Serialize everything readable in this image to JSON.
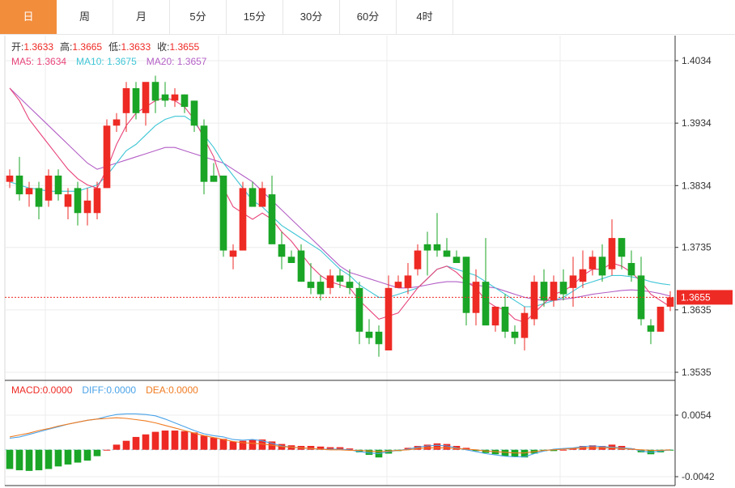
{
  "tabs": [
    "日",
    "周",
    "月",
    "5分",
    "15分",
    "30分",
    "60分",
    "4时"
  ],
  "active_tab": 0,
  "colors": {
    "up": "#ee2a24",
    "down": "#1aa526",
    "ma5": "#e8457a",
    "ma10": "#3fc6d6",
    "ma20": "#b35fc6",
    "diff": "#4aa3e8",
    "dea": "#f07c22",
    "accent": "#f28d3c"
  },
  "chart_data": [
    {
      "type": "candlestick",
      "ohlc_labels": {
        "open_label": "开:",
        "open": "1.3633",
        "high_label": "高:",
        "high": "1.3665",
        "low_label": "低:",
        "low": "1.3633",
        "close_label": "收:",
        "close": "1.3655"
      },
      "ma_labels": {
        "ma5": "MA5: 1.3634",
        "ma10": "MA10: 1.3675",
        "ma20": "MA20: 1.3657"
      },
      "y_ticks": [
        "1.4034",
        "1.3934",
        "1.3834",
        "1.3735",
        "1.3635",
        "1.3535"
      ],
      "y_tick_values": [
        1.4034,
        1.3934,
        1.3834,
        1.3735,
        1.3635,
        1.3535
      ],
      "ylim": [
        1.3535,
        1.4034
      ],
      "current_price": "1.3655",
      "current_value": 1.3655,
      "candles": [
        [
          1.384,
          1.386,
          1.383,
          1.385
        ],
        [
          1.385,
          1.388,
          1.381,
          1.382
        ],
        [
          1.382,
          1.384,
          1.38,
          1.383
        ],
        [
          1.383,
          1.384,
          1.378,
          1.38
        ],
        [
          1.381,
          1.386,
          1.38,
          1.385
        ],
        [
          1.385,
          1.386,
          1.381,
          1.382
        ],
        [
          1.38,
          1.383,
          1.378,
          1.382
        ],
        [
          1.383,
          1.384,
          1.377,
          1.379
        ],
        [
          1.379,
          1.383,
          1.377,
          1.381
        ],
        [
          1.379,
          1.384,
          1.378,
          1.383
        ],
        [
          1.383,
          1.394,
          1.383,
          1.393
        ],
        [
          1.393,
          1.395,
          1.392,
          1.394
        ],
        [
          1.395,
          1.4,
          1.392,
          1.399
        ],
        [
          1.399,
          1.4,
          1.394,
          1.395
        ],
        [
          1.395,
          1.399,
          1.393,
          1.4
        ],
        [
          1.4,
          1.401,
          1.395,
          1.397
        ],
        [
          1.398,
          1.4,
          1.396,
          1.397
        ],
        [
          1.397,
          1.399,
          1.396,
          1.398
        ],
        [
          1.398,
          1.398,
          1.395,
          1.396
        ],
        [
          1.397,
          1.397,
          1.392,
          1.393
        ],
        [
          1.393,
          1.394,
          1.382,
          1.384
        ],
        [
          1.385,
          1.387,
          1.384,
          1.384
        ],
        [
          1.385,
          1.385,
          1.372,
          1.373
        ],
        [
          1.372,
          1.374,
          1.37,
          1.373
        ],
        [
          1.373,
          1.384,
          1.373,
          1.383
        ],
        [
          1.383,
          1.384,
          1.38,
          1.38
        ],
        [
          1.38,
          1.384,
          1.38,
          1.383
        ],
        [
          1.382,
          1.385,
          1.379,
          1.374
        ],
        [
          1.374,
          1.376,
          1.37,
          1.372
        ],
        [
          1.372,
          1.373,
          1.371,
          1.371
        ],
        [
          1.373,
          1.374,
          1.368,
          1.368
        ],
        [
          1.368,
          1.371,
          1.366,
          1.367
        ],
        [
          1.368,
          1.369,
          1.365,
          1.366
        ],
        [
          1.367,
          1.37,
          1.366,
          1.369
        ],
        [
          1.369,
          1.37,
          1.367,
          1.368
        ],
        [
          1.368,
          1.37,
          1.366,
          1.367
        ],
        [
          1.367,
          1.368,
          1.358,
          1.36
        ],
        [
          1.36,
          1.362,
          1.358,
          1.359
        ],
        [
          1.36,
          1.361,
          1.356,
          1.358
        ],
        [
          1.357,
          1.369,
          1.357,
          1.367
        ],
        [
          1.367,
          1.369,
          1.367,
          1.368
        ],
        [
          1.367,
          1.371,
          1.366,
          1.369
        ],
        [
          1.37,
          1.374,
          1.369,
          1.373
        ],
        [
          1.374,
          1.376,
          1.369,
          1.373
        ],
        [
          1.374,
          1.379,
          1.372,
          1.373
        ],
        [
          1.373,
          1.375,
          1.372,
          1.372
        ],
        [
          1.372,
          1.373,
          1.371,
          1.371
        ],
        [
          1.372,
          1.372,
          1.361,
          1.363
        ],
        [
          1.363,
          1.37,
          1.361,
          1.368
        ],
        [
          1.368,
          1.375,
          1.363,
          1.361
        ],
        [
          1.361,
          1.364,
          1.36,
          1.364
        ],
        [
          1.364,
          1.366,
          1.359,
          1.36
        ],
        [
          1.36,
          1.361,
          1.358,
          1.359
        ],
        [
          1.359,
          1.364,
          1.357,
          1.363
        ],
        [
          1.362,
          1.369,
          1.361,
          1.368
        ],
        [
          1.368,
          1.37,
          1.364,
          1.365
        ],
        [
          1.365,
          1.369,
          1.364,
          1.368
        ],
        [
          1.368,
          1.37,
          1.365,
          1.366
        ],
        [
          1.367,
          1.372,
          1.364,
          1.369
        ],
        [
          1.368,
          1.373,
          1.367,
          1.37
        ],
        [
          1.37,
          1.373,
          1.369,
          1.372
        ],
        [
          1.372,
          1.374,
          1.368,
          1.369
        ],
        [
          1.37,
          1.378,
          1.369,
          1.375
        ],
        [
          1.375,
          1.375,
          1.37,
          1.372
        ],
        [
          1.371,
          1.373,
          1.368,
          1.369
        ],
        [
          1.369,
          1.372,
          1.361,
          1.362
        ],
        [
          1.361,
          1.362,
          1.358,
          1.36
        ],
        [
          1.36,
          1.364,
          1.36,
          1.364
        ],
        [
          1.364,
          1.3665,
          1.3633,
          1.3655
        ]
      ],
      "ma5_values": [
        1.399,
        1.397,
        1.394,
        1.392,
        1.39,
        1.388,
        1.386,
        1.3845,
        1.3835,
        1.383,
        1.386,
        1.39,
        1.393,
        1.395,
        1.396,
        1.397,
        1.3975,
        1.397,
        1.396,
        1.394,
        1.391,
        1.388,
        1.383,
        1.38,
        1.379,
        1.378,
        1.379,
        1.378,
        1.376,
        1.3745,
        1.3725,
        1.3705,
        1.369,
        1.368,
        1.3675,
        1.367,
        1.365,
        1.3635,
        1.362,
        1.3625,
        1.363,
        1.365,
        1.367,
        1.3685,
        1.37,
        1.3705,
        1.3695,
        1.368,
        1.367,
        1.365,
        1.364,
        1.3635,
        1.362,
        1.3615,
        1.363,
        1.3645,
        1.366,
        1.3665,
        1.3675,
        1.369,
        1.37,
        1.37,
        1.371,
        1.3705,
        1.3695,
        1.368,
        1.366,
        1.365,
        1.364
      ],
      "ma10_values": [
        1.384,
        1.3835,
        1.383,
        1.3828,
        1.3825,
        1.3825,
        1.3825,
        1.3825,
        1.383,
        1.3835,
        1.385,
        1.387,
        1.389,
        1.39,
        1.3915,
        1.393,
        1.394,
        1.3945,
        1.3945,
        1.3935,
        1.3915,
        1.3895,
        1.387,
        1.385,
        1.383,
        1.381,
        1.38,
        1.3785,
        1.377,
        1.376,
        1.375,
        1.374,
        1.373,
        1.3715,
        1.37,
        1.369,
        1.3675,
        1.3665,
        1.3655,
        1.3655,
        1.366,
        1.3665,
        1.367,
        1.3685,
        1.37,
        1.3705,
        1.37,
        1.3695,
        1.369,
        1.368,
        1.367,
        1.366,
        1.365,
        1.364,
        1.364,
        1.3645,
        1.365,
        1.3655,
        1.3665,
        1.3675,
        1.368,
        1.3685,
        1.369,
        1.369,
        1.3688,
        1.3685,
        1.368,
        1.3677,
        1.3675
      ],
      "ma20_values": [
        1.399,
        1.3975,
        1.396,
        1.3945,
        1.393,
        1.3915,
        1.39,
        1.3885,
        1.387,
        1.386,
        1.3865,
        1.387,
        1.3875,
        1.388,
        1.3885,
        1.389,
        1.3895,
        1.3895,
        1.389,
        1.3885,
        1.388,
        1.3875,
        1.387,
        1.386,
        1.385,
        1.384,
        1.3825,
        1.381,
        1.3795,
        1.378,
        1.3765,
        1.375,
        1.3735,
        1.372,
        1.3705,
        1.3695,
        1.369,
        1.3685,
        1.368,
        1.3675,
        1.367,
        1.367,
        1.3672,
        1.3675,
        1.3678,
        1.368,
        1.368,
        1.3678,
        1.3675,
        1.3672,
        1.367,
        1.3665,
        1.366,
        1.3655,
        1.3652,
        1.365,
        1.365,
        1.3652,
        1.3654,
        1.3657,
        1.366,
        1.3662,
        1.3664,
        1.3666,
        1.3667,
        1.3666,
        1.3664,
        1.3661,
        1.3657
      ]
    },
    {
      "type": "bar",
      "labels": {
        "macd": "MACD:0.0000",
        "diff": "DIFF:0.0000",
        "dea": "DEA:0.0000"
      },
      "y_ticks": [
        "0.0054",
        "-0.0042"
      ],
      "y_tick_values": [
        0.0054,
        -0.0042
      ],
      "ylim": [
        -0.0042,
        0.0054
      ],
      "macd": [
        -0.003,
        -0.0032,
        -0.0033,
        -0.0032,
        -0.003,
        -0.0026,
        -0.0023,
        -0.002,
        -0.0017,
        -0.001,
        0.0,
        0.0008,
        0.0014,
        0.002,
        0.0024,
        0.0028,
        0.003,
        0.003,
        0.0029,
        0.0027,
        0.0022,
        0.0019,
        0.0017,
        0.0013,
        0.0014,
        0.0016,
        0.0016,
        0.0013,
        0.0009,
        0.0007,
        0.0006,
        0.0006,
        0.0005,
        0.0004,
        0.0004,
        0.0002,
        -0.0004,
        -0.0008,
        -0.0012,
        -0.0006,
        -0.0002,
        0.0003,
        0.0006,
        0.0008,
        0.001,
        0.0009,
        0.0006,
        0.0003,
        -0.0002,
        -0.0005,
        -0.0007,
        -0.001,
        -0.0011,
        -0.0012,
        -0.0006,
        -0.0002,
        -0.0002,
        0.0,
        0.0002,
        0.0006,
        0.0007,
        0.0006,
        0.0008,
        0.0006,
        0.0002,
        -0.0004,
        -0.0007,
        -0.0004,
        -0.0001
      ],
      "diff": [
        0.0018,
        0.002,
        0.0024,
        0.0028,
        0.0032,
        0.0036,
        0.004,
        0.0043,
        0.0046,
        0.0048,
        0.0052,
        0.0055,
        0.0056,
        0.0056,
        0.0055,
        0.0053,
        0.0048,
        0.0042,
        0.0036,
        0.003,
        0.0025,
        0.0022,
        0.002,
        0.0016,
        0.0015,
        0.0016,
        0.0014,
        0.001,
        0.0006,
        0.0004,
        0.0003,
        0.0002,
        0.0001,
        0.0001,
        0.0001,
        0.0,
        -0.0003,
        -0.0005,
        -0.0006,
        -0.0003,
        -0.0001,
        0.0001,
        0.0004,
        0.0006,
        0.0007,
        0.0006,
        0.0003,
        0.0,
        -0.0003,
        -0.0006,
        -0.0008,
        -0.001,
        -0.0011,
        -0.0011,
        -0.0006,
        -0.0002,
        0.0001,
        0.0002,
        0.0003,
        0.0005,
        0.0006,
        0.0005,
        0.0004,
        0.0003,
        0.0002,
        -0.0002,
        -0.0004,
        -0.0002,
        0.0
      ],
      "dea": [
        0.002,
        0.0023,
        0.0026,
        0.003,
        0.0033,
        0.0037,
        0.004,
        0.0043,
        0.0046,
        0.0048,
        0.0049,
        0.005,
        0.0049,
        0.0047,
        0.0045,
        0.0042,
        0.0038,
        0.0034,
        0.003,
        0.0026,
        0.0022,
        0.0019,
        0.0016,
        0.0013,
        0.0011,
        0.001,
        0.0009,
        0.0007,
        0.0005,
        0.0004,
        0.0003,
        0.0002,
        0.0001,
        0.0,
        0.0,
        -0.0001,
        -0.0001,
        -0.0002,
        -0.0003,
        -0.0002,
        -0.0001,
        0.0,
        0.0002,
        0.0003,
        0.0003,
        0.0003,
        0.0002,
        0.0001,
        0.0,
        -0.0002,
        -0.0003,
        -0.0004,
        -0.0005,
        -0.0005,
        -0.0003,
        -0.0001,
        0.0,
        0.0001,
        0.0002,
        0.0003,
        0.0003,
        0.0003,
        0.0003,
        0.0002,
        0.0001,
        0.0,
        -0.0001,
        -0.0001,
        0.0
      ]
    }
  ]
}
